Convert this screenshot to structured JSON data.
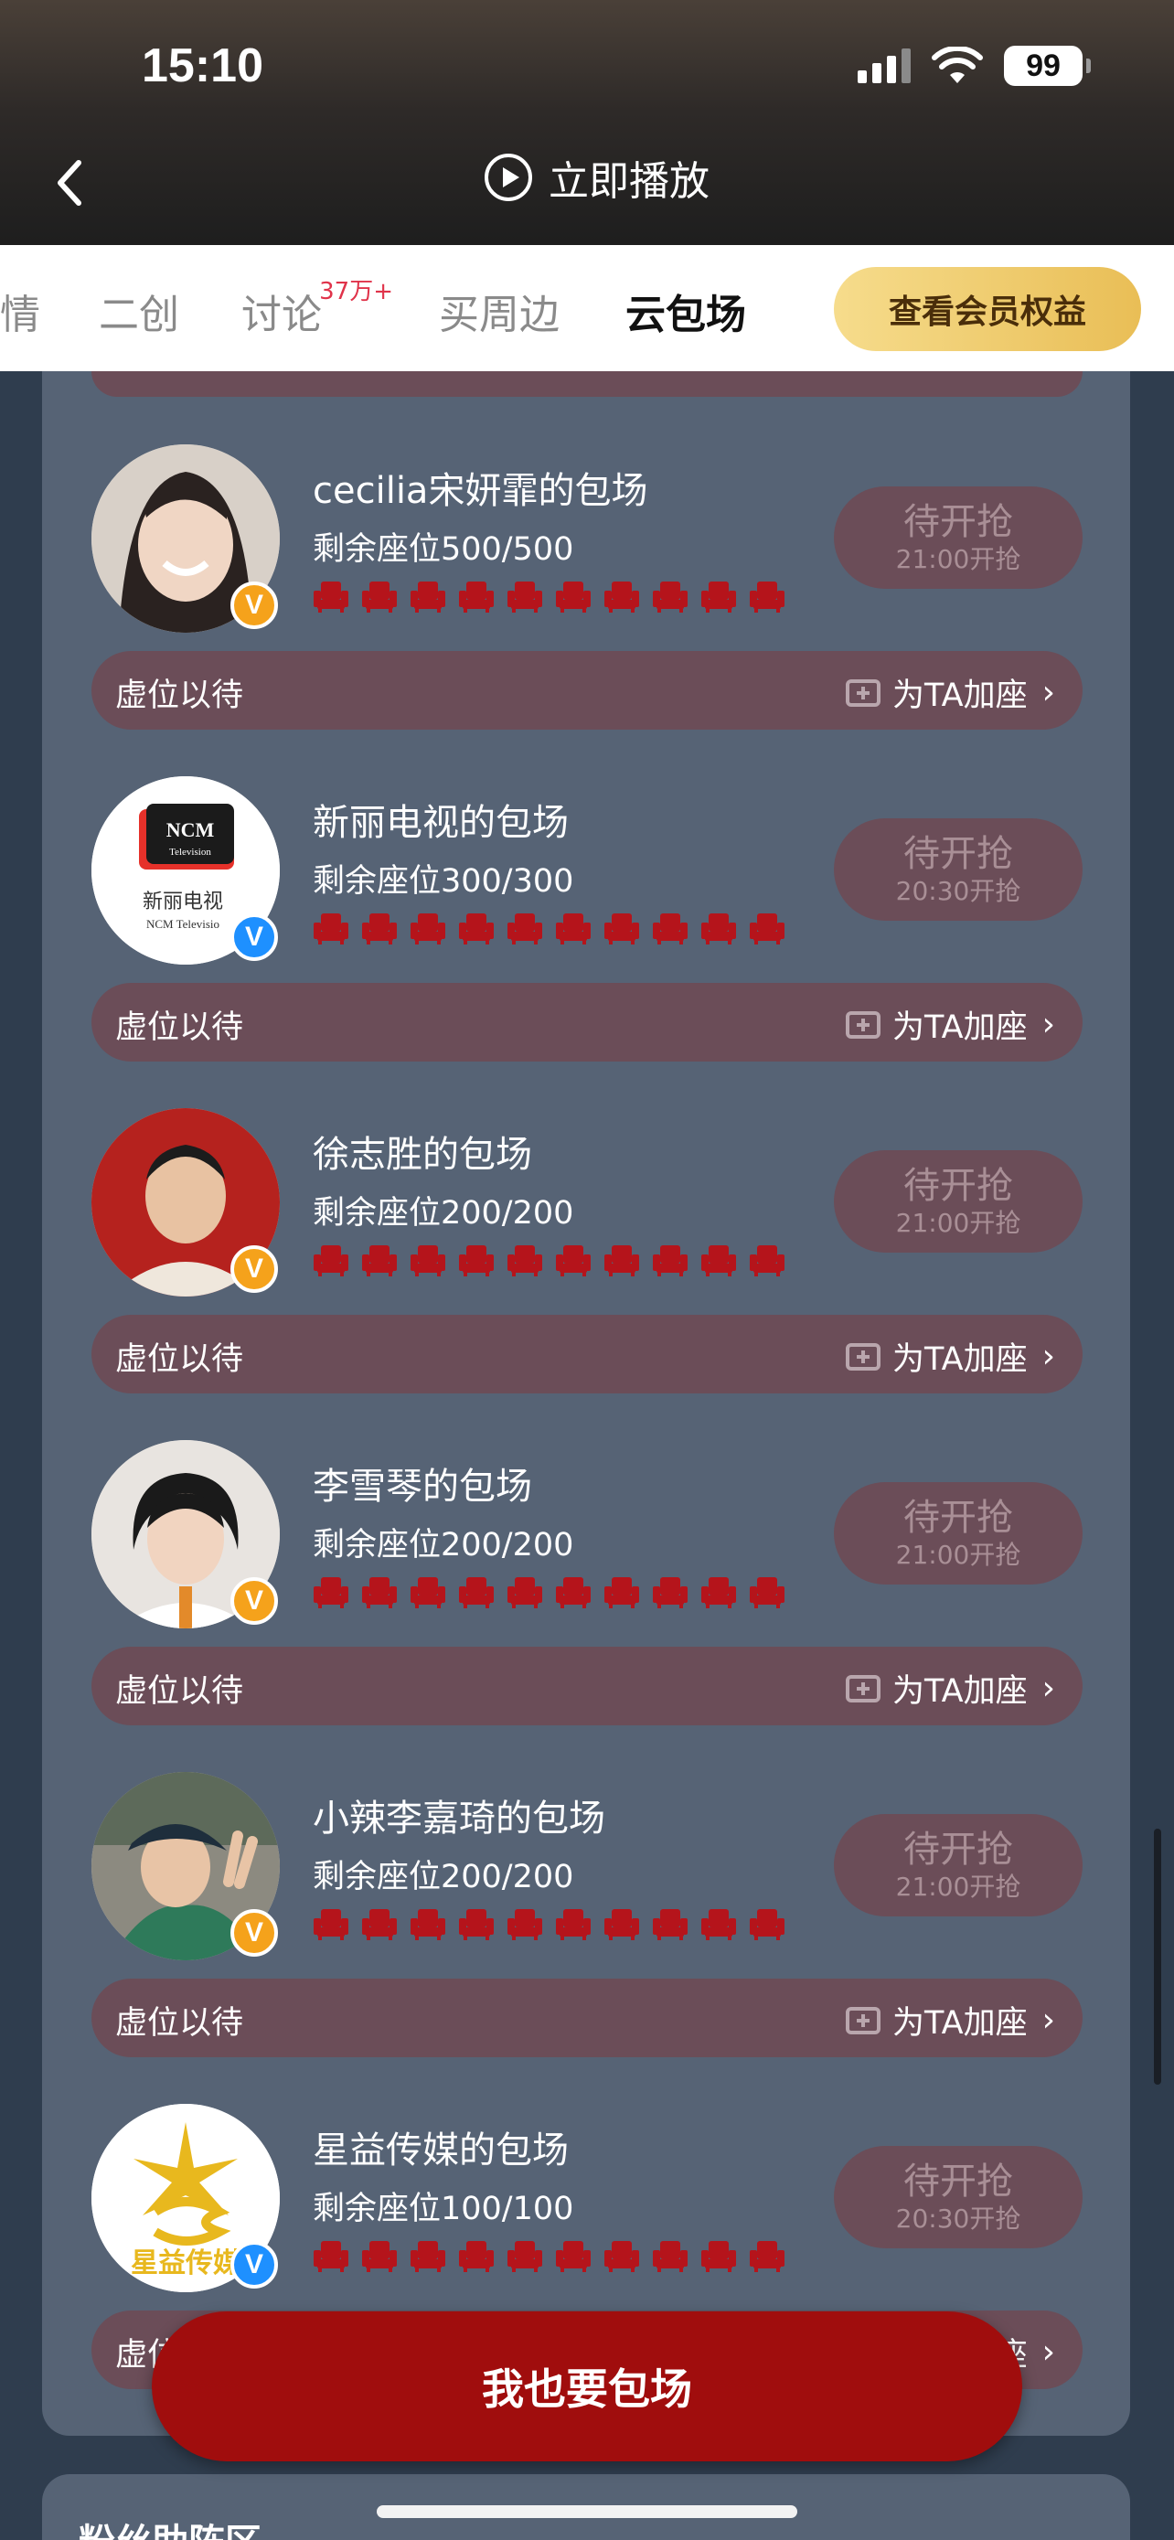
{
  "status_bar": {
    "time": "15:10",
    "battery": "99"
  },
  "header": {
    "play_label": "立即播放"
  },
  "tabs": [
    {
      "label": "情",
      "active": false
    },
    {
      "label": "二创",
      "active": false
    },
    {
      "label": "讨论",
      "badge": "37万+",
      "active": false
    },
    {
      "label": "买周边",
      "active": false
    },
    {
      "label": "云包场",
      "active": true
    }
  ],
  "member_button": "查看会员权益",
  "cards": [
    {
      "title": "cecilia宋妍霏的包场",
      "seats": "剩余座位500/500",
      "status": "待开抢",
      "time": "21:00开抢",
      "footer_left": "虚位以待",
      "footer_right": "为TA加座",
      "badge": "orange"
    },
    {
      "title": "新丽电视的包场",
      "seats": "剩余座位300/300",
      "status": "待开抢",
      "time": "20:30开抢",
      "footer_left": "虚位以待",
      "footer_right": "为TA加座",
      "badge": "blue",
      "avatar_text": "新丽电视",
      "avatar_text2": "NCM Televisio"
    },
    {
      "title": "徐志胜的包场",
      "seats": "剩余座位200/200",
      "status": "待开抢",
      "time": "21:00开抢",
      "footer_left": "虚位以待",
      "footer_right": "为TA加座",
      "badge": "orange"
    },
    {
      "title": "李雪琴的包场",
      "seats": "剩余座位200/200",
      "status": "待开抢",
      "time": "21:00开抢",
      "footer_left": "虚位以待",
      "footer_right": "为TA加座",
      "badge": "orange"
    },
    {
      "title": "小辣李嘉琦的包场",
      "seats": "剩余座位200/200",
      "status": "待开抢",
      "time": "21:00开抢",
      "footer_left": "虚位以待",
      "footer_right": "为TA加座",
      "badge": "orange"
    },
    {
      "title": "星益传媒的包场",
      "seats": "剩余座位100/100",
      "status": "待开抢",
      "time": "20:30开抢",
      "footer_left": "虚位",
      "footer_right": "座",
      "badge": "blue",
      "avatar_text": "星益传媒"
    }
  ],
  "ncm_logo": "NCM",
  "ncm_logo_sub": "Television",
  "badge_letter": "V",
  "main_button": "我也要包场",
  "fan_section_title": "粉丝助阵区",
  "colors": {
    "brand_red": "#a00d0d",
    "seat_red": "#b5141b",
    "card_bg": "#6b4d58",
    "panel_bg": "#566375",
    "gold": "#e9be56"
  }
}
